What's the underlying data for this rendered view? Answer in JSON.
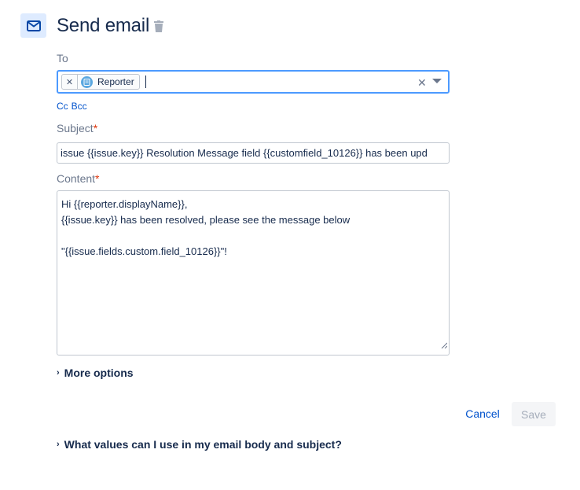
{
  "header": {
    "title": "Send email",
    "icon": "mail-icon",
    "accent_color": "#0052cc",
    "icon_bg_color": "#deebff"
  },
  "to": {
    "label": "To",
    "chips": [
      {
        "label": "Reporter",
        "icon": "reporter-avatar-icon"
      }
    ],
    "cc_label": "Cc",
    "bcc_label": "Bcc",
    "focus_color": "#4c9aff"
  },
  "subject": {
    "label": "Subject",
    "required_mark": "*",
    "value": "issue {{issue.key}} Resolution Message field {{customfield_10126}} has been upd"
  },
  "content": {
    "label": "Content",
    "required_mark": "*",
    "lines": [
      "Hi {{reporter.displayName}},",
      "{{issue.key}} has been resolved, please see the message below",
      "",
      "\"{{issue.fields.custom.field_10126}}\"!"
    ]
  },
  "more_options": {
    "label": "More options"
  },
  "actions": {
    "cancel_label": "Cancel",
    "save_label": "Save"
  },
  "help": {
    "label": "What values can I use in my email body and subject?"
  }
}
